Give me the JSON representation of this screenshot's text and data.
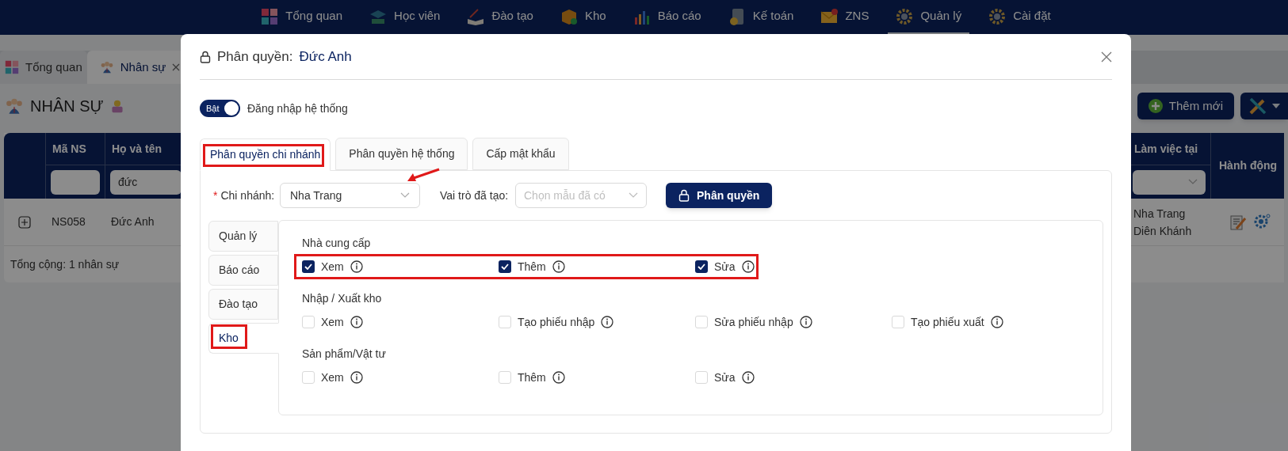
{
  "nav": {
    "items": [
      {
        "label": "Tổng quan",
        "selected": false
      },
      {
        "label": "Học viên",
        "selected": false
      },
      {
        "label": "Đào tạo",
        "selected": false
      },
      {
        "label": "Kho",
        "selected": false
      },
      {
        "label": "Báo cáo",
        "selected": false
      },
      {
        "label": "Kế toán",
        "selected": false
      },
      {
        "label": "ZNS",
        "selected": false
      },
      {
        "label": "Quản lý",
        "selected": true
      },
      {
        "label": "Cài đặt",
        "selected": false
      }
    ]
  },
  "page_tabs": [
    {
      "label": "Tổng quan",
      "selected": false,
      "closable": false
    },
    {
      "label": "Nhân sự",
      "selected": true,
      "closable": true
    }
  ],
  "page_title": "NHÂN SỰ",
  "add_button": "Thêm mới",
  "table": {
    "left_columns": [
      {
        "label": "Mã NS"
      },
      {
        "label": "Họ và tên",
        "filter": "đức"
      }
    ],
    "right_columns": [
      {
        "label": "Làm việc tại",
        "kind": "select"
      },
      {
        "label": "Hành động"
      }
    ],
    "rows": [
      {
        "code": "NS058",
        "name": "Đức Anh",
        "workplaces": [
          "Nha Trang",
          "Diên Khánh"
        ]
      }
    ],
    "footer": "Tổng cộng: 1 nhân sự"
  },
  "modal": {
    "title": "Phân quyền:",
    "subject": "Đức Anh",
    "login_toggle": {
      "on": true,
      "on_label": "Bật",
      "label": "Đăng nhập hệ thống"
    },
    "tabs": [
      {
        "label": "Phân quyền chi nhánh",
        "selected": true,
        "highlighted": true
      },
      {
        "label": "Phân quyền hệ thống",
        "selected": false,
        "highlighted": false
      },
      {
        "label": "Cấp mật khẩu",
        "selected": false,
        "highlighted": false
      }
    ],
    "branch": {
      "label": "Chi nhánh:",
      "required_mark": "*",
      "value": "Nha Trang",
      "pointed": true
    },
    "role": {
      "label": "Vai trò đã tạo:",
      "placeholder": "Chọn mẫu đã có"
    },
    "apply_button": "Phân quyền",
    "sections": [
      {
        "label": "Quản lý",
        "selected": false,
        "highlighted": false
      },
      {
        "label": "Báo cáo",
        "selected": false,
        "highlighted": false
      },
      {
        "label": "Đào tạo",
        "selected": false,
        "highlighted": false
      },
      {
        "label": "Kho",
        "selected": true,
        "highlighted": true
      }
    ],
    "groups": [
      {
        "title": "Nhà cung cấp",
        "highlighted": true,
        "permissions": [
          {
            "label": "Xem",
            "checked": true
          },
          {
            "label": "Thêm",
            "checked": true
          },
          {
            "label": "Sửa",
            "checked": true
          }
        ]
      },
      {
        "title": "Nhập / Xuất kho",
        "highlighted": false,
        "permissions": [
          {
            "label": "Xem",
            "checked": false
          },
          {
            "label": "Tạo phiếu nhập",
            "checked": false
          },
          {
            "label": "Sửa phiếu nhập",
            "checked": false
          },
          {
            "label": "Tạo phiếu xuất",
            "checked": false
          }
        ]
      },
      {
        "title": "Sản phẩm/Vật tư",
        "highlighted": false,
        "permissions": [
          {
            "label": "Xem",
            "checked": false
          },
          {
            "label": "Thêm",
            "checked": false
          },
          {
            "label": "Sửa",
            "checked": false
          }
        ]
      }
    ]
  }
}
